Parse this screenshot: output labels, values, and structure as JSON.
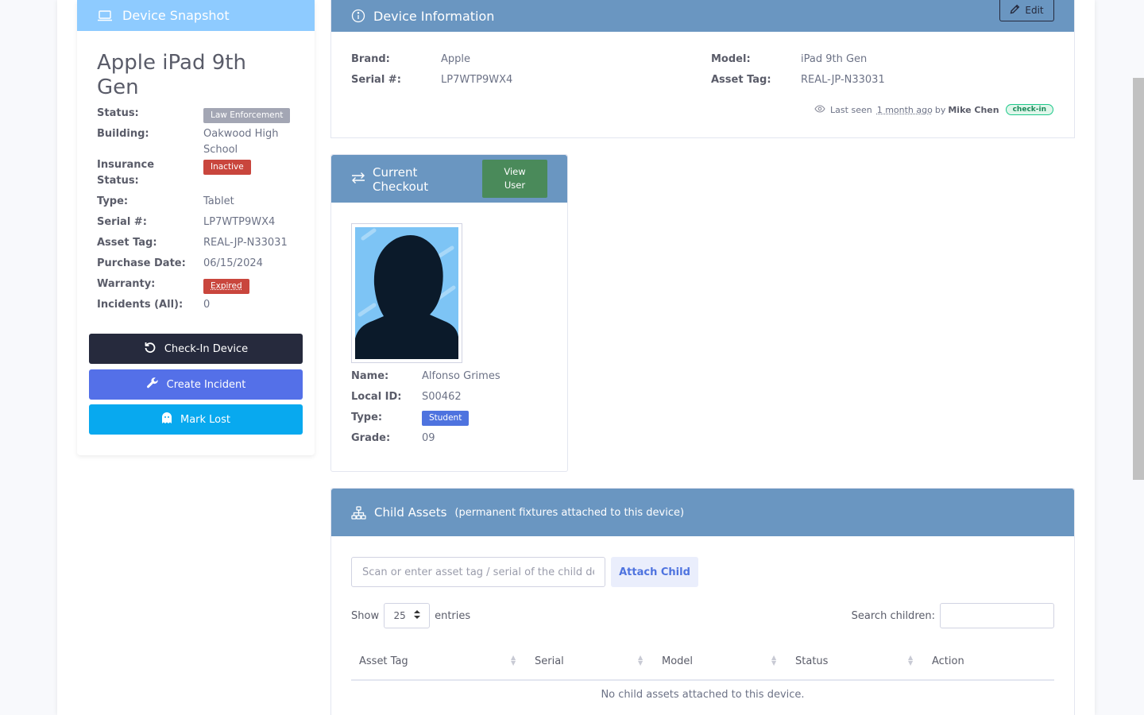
{
  "snapshot": {
    "header": "Device Snapshot",
    "title": "Apple iPad 9th Gen",
    "fields": {
      "status_label": "Status:",
      "status_value": "Law Enforcement",
      "building_label": "Building:",
      "building_value": "Oakwood High School",
      "insurance_label": "Insurance Status:",
      "insurance_value": "Inactive",
      "type_label": "Type:",
      "type_value": "Tablet",
      "serial_label": "Serial #:",
      "serial_value": "LP7WTP9WX4",
      "asset_label": "Asset Tag:",
      "asset_value": "REAL-JP-N33031",
      "purchase_label": "Purchase Date:",
      "purchase_value": "06/15/2024",
      "warranty_label": "Warranty:",
      "warranty_value": "Expired",
      "incidents_label": "Incidents (All):",
      "incidents_value": "0"
    },
    "buttons": {
      "checkin": "Check-In Device",
      "incident": "Create Incident",
      "lost": "Mark Lost"
    },
    "colors": {
      "header": "#8ecbff",
      "checkin": "#262a3d",
      "incident": "#5470e8",
      "lost": "#08a9ef"
    }
  },
  "device_info": {
    "header": "Device Information",
    "edit_label": "Edit",
    "brand_label": "Brand:",
    "brand_value": "Apple",
    "serial_label": "Serial #:",
    "serial_value": "LP7WTP9WX4",
    "model_label": "Model:",
    "model_value": "iPad 9th Gen",
    "asset_label": "Asset Tag:",
    "asset_value": "REAL-JP-N33031",
    "last_seen_prefix": "Last seen",
    "last_seen_time": "1 month ago",
    "last_seen_by": "by",
    "last_seen_user": "Mike Chen",
    "last_seen_action": "check-in"
  },
  "checkout": {
    "header": "Current Checkout",
    "view_user": "View User",
    "name_label": "Name:",
    "name_value": "Alfonso Grimes",
    "localid_label": "Local ID:",
    "localid_value": "S00462",
    "type_label": "Type:",
    "type_value": "Student",
    "grade_label": "Grade:",
    "grade_value": "09"
  },
  "child_assets": {
    "header": "Child Assets",
    "subheader": "(permanent fixtures attached to this device)",
    "scan_placeholder": "Scan or enter asset tag / serial of the child device",
    "attach_label": "Attach Child",
    "show_label": "Show",
    "entries_value": "25",
    "entries_label": "entries",
    "search_label": "Search children:",
    "columns": [
      "Asset Tag",
      "Serial",
      "Model",
      "Status",
      "Action"
    ],
    "empty_message": "No child assets attached to this device."
  }
}
